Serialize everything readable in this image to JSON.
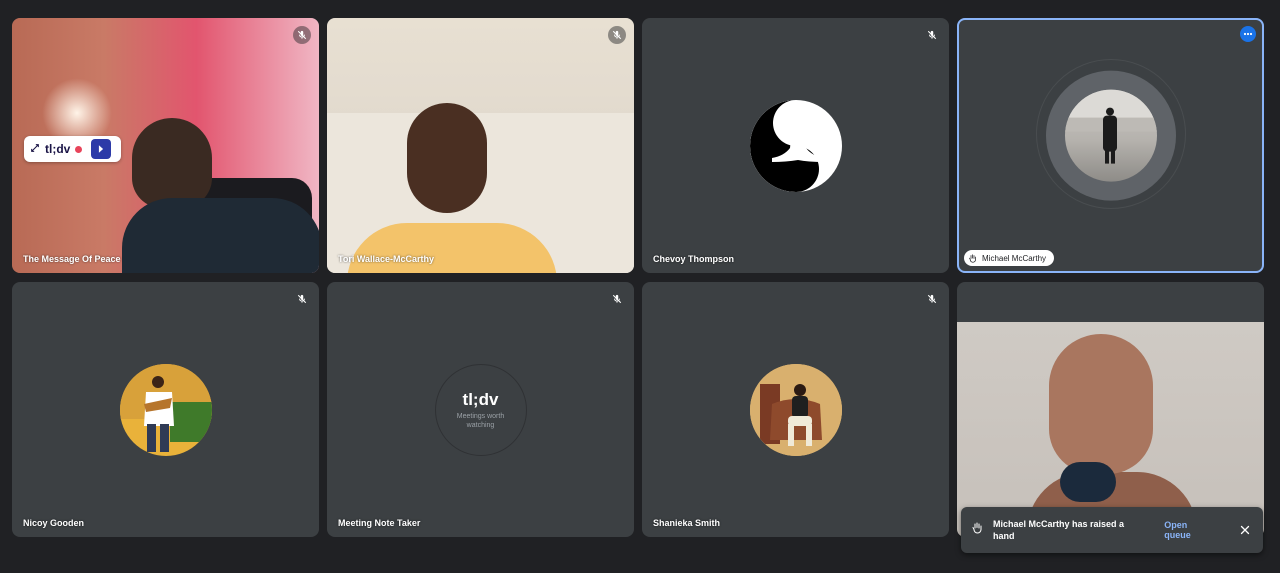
{
  "participants": [
    {
      "name": "The Message Of Peace"
    },
    {
      "name": "Tori Wallace-McCarthy"
    },
    {
      "name": "Chevoy Thompson"
    },
    {
      "name": "Michael McCarthy"
    },
    {
      "name": "Nicoy Gooden"
    },
    {
      "name": "Meeting Note Taker"
    },
    {
      "name": "Shanieka Smith"
    }
  ],
  "tldv_overlay": {
    "logo": "tl;dv"
  },
  "note_taker_avatar": {
    "title": "tl;dv",
    "subtitle": "Meetings worth watching"
  },
  "toast": {
    "message": "Michael McCarthy has raised a hand",
    "action_label": "Open queue"
  },
  "colors": {
    "tile_bg": "#3c4043",
    "page_bg": "#202124",
    "active_outline": "#8ab4f8",
    "link": "#8ab4f8",
    "more_button": "#1a73e8"
  },
  "icons": {
    "mute": "mic-off-icon",
    "more": "more-options-icon",
    "hand": "raised-hand-icon",
    "close": "close-icon",
    "expand": "expand-icon"
  }
}
